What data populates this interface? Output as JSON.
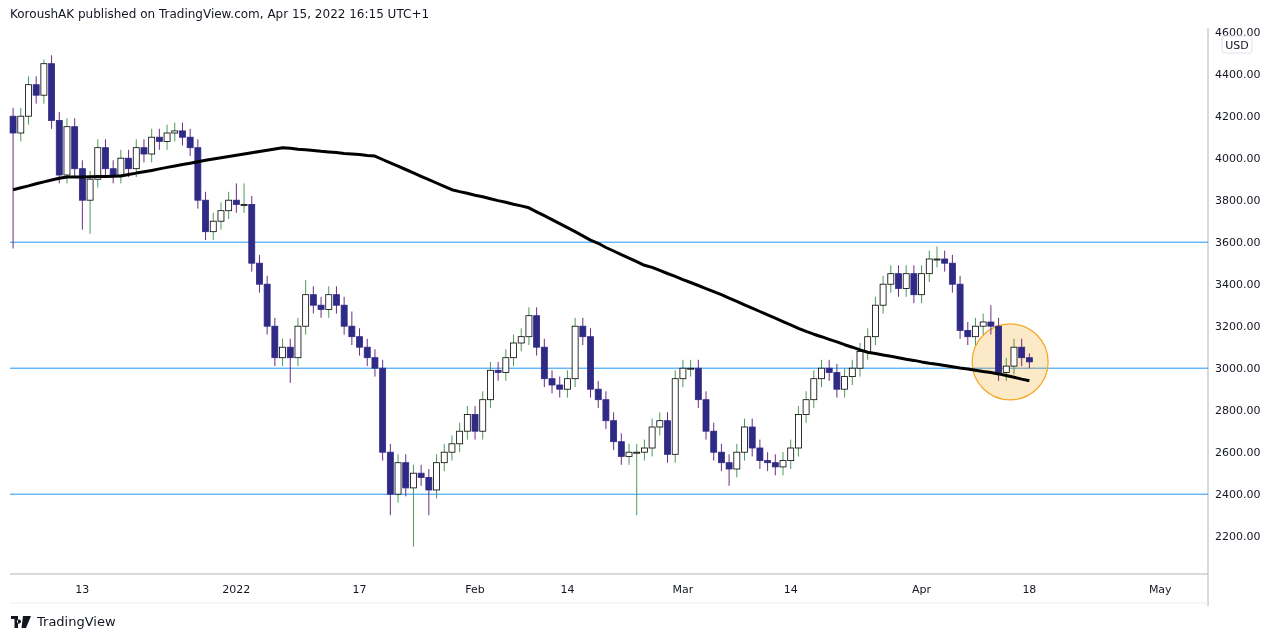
{
  "header": {
    "text": "KoroushAK published on TradingView.com, Apr 15, 2022 16:15 UTC+1"
  },
  "chart": {
    "chart_data": {
      "type": "candlestick",
      "ylabel": "USD",
      "ylim": [
        2020,
        4620
      ],
      "yticks": [
        {
          "value": 4600,
          "label": "4600.00"
        },
        {
          "value": 4400,
          "label": "4400.00"
        },
        {
          "value": 4200,
          "label": "4200.00"
        },
        {
          "value": 4000,
          "label": "4000.00"
        },
        {
          "value": 3800,
          "label": "3800.00"
        },
        {
          "value": 3600,
          "label": "3600.00"
        },
        {
          "value": 3400,
          "label": "3400.00"
        },
        {
          "value": 3200,
          "label": "3200.00"
        },
        {
          "value": 3000,
          "label": "3000.00"
        },
        {
          "value": 2800,
          "label": "2800.00"
        },
        {
          "value": 2600,
          "label": "2600.00"
        },
        {
          "value": 2400,
          "label": "2400.00"
        },
        {
          "value": 2200,
          "label": "2200.00"
        }
      ],
      "categories": [
        null,
        null,
        null,
        null,
        null,
        null,
        null,
        null,
        null,
        "13",
        null,
        null,
        null,
        null,
        null,
        null,
        null,
        null,
        null,
        null,
        null,
        null,
        null,
        null,
        null,
        null,
        null,
        null,
        null,
        "2022",
        null,
        null,
        null,
        null,
        null,
        null,
        null,
        null,
        null,
        null,
        null,
        null,
        null,
        null,
        null,
        "17",
        null,
        null,
        null,
        null,
        null,
        null,
        null,
        null,
        null,
        null,
        null,
        null,
        null,
        null,
        "Feb",
        null,
        null,
        null,
        null,
        null,
        null,
        null,
        null,
        null,
        null,
        null,
        "14",
        null,
        null,
        null,
        null,
        null,
        null,
        null,
        null,
        null,
        null,
        null,
        null,
        null,
        null,
        "Mar",
        null,
        null,
        null,
        null,
        null,
        null,
        null,
        null,
        null,
        null,
        null,
        null,
        null,
        "14",
        null,
        null,
        null,
        null,
        null,
        null,
        null,
        null,
        null,
        null,
        null,
        null,
        null,
        null,
        null,
        null,
        "Apr",
        null,
        null,
        null,
        null,
        null,
        null,
        null,
        null,
        null,
        null,
        null,
        null,
        null,
        "18",
        null,
        null,
        null,
        null,
        null,
        null,
        null,
        null,
        null,
        null,
        null,
        null,
        null,
        null,
        null,
        null,
        "May",
        null,
        null,
        null,
        null,
        null,
        null
      ],
      "ohlc": [
        [
          4200,
          4240,
          3570,
          4120
        ],
        [
          4120,
          4240,
          4080,
          4200
        ],
        [
          4200,
          4390,
          4160,
          4350
        ],
        [
          4350,
          4390,
          4260,
          4300
        ],
        [
          4300,
          4470,
          4260,
          4450
        ],
        [
          4450,
          4490,
          4140,
          4180
        ],
        [
          4180,
          4220,
          3880,
          3920
        ],
        [
          3920,
          4190,
          3880,
          4150
        ],
        [
          4150,
          4190,
          3910,
          3950
        ],
        [
          3950,
          3990,
          3660,
          3800
        ],
        [
          3800,
          3940,
          3640,
          3900
        ],
        [
          3900,
          4090,
          3860,
          4050
        ],
        [
          4050,
          4090,
          3910,
          3950
        ],
        [
          3950,
          3990,
          3880,
          3920
        ],
        [
          3920,
          4040,
          3880,
          4000
        ],
        [
          4000,
          4040,
          3910,
          3950
        ],
        [
          3950,
          4090,
          3910,
          4050
        ],
        [
          4050,
          4090,
          3980,
          4020
        ],
        [
          4020,
          4140,
          3980,
          4100
        ],
        [
          4100,
          4140,
          4040,
          4080
        ],
        [
          4080,
          4160,
          4040,
          4120
        ],
        [
          4120,
          4170,
          4080,
          4130
        ],
        [
          4130,
          4170,
          4060,
          4100
        ],
        [
          4100,
          4140,
          4010,
          4050
        ],
        [
          4050,
          4090,
          3760,
          3800
        ],
        [
          3800,
          3840,
          3610,
          3650
        ],
        [
          3650,
          3740,
          3610,
          3700
        ],
        [
          3700,
          3790,
          3660,
          3750
        ],
        [
          3750,
          3840,
          3710,
          3800
        ],
        [
          3800,
          3880,
          3740,
          3780
        ],
        [
          3780,
          3880,
          3740,
          3780
        ],
        [
          3780,
          3820,
          3460,
          3500
        ],
        [
          3500,
          3540,
          3360,
          3400
        ],
        [
          3400,
          3440,
          3160,
          3200
        ],
        [
          3200,
          3240,
          3010,
          3050
        ],
        [
          3050,
          3140,
          3010,
          3100
        ],
        [
          3100,
          3140,
          2930,
          3050
        ],
        [
          3050,
          3240,
          3010,
          3200
        ],
        [
          3200,
          3420,
          3160,
          3350
        ],
        [
          3350,
          3390,
          3260,
          3300
        ],
        [
          3300,
          3340,
          3240,
          3280
        ],
        [
          3280,
          3390,
          3240,
          3350
        ],
        [
          3350,
          3390,
          3260,
          3300
        ],
        [
          3300,
          3340,
          3160,
          3200
        ],
        [
          3200,
          3270,
          3110,
          3150
        ],
        [
          3150,
          3190,
          3060,
          3100
        ],
        [
          3100,
          3140,
          3010,
          3050
        ],
        [
          3050,
          3090,
          2960,
          3000
        ],
        [
          3000,
          3040,
          2560,
          2600
        ],
        [
          2600,
          2640,
          2300,
          2400
        ],
        [
          2400,
          2590,
          2360,
          2550
        ],
        [
          2550,
          2590,
          2390,
          2430
        ],
        [
          2430,
          2540,
          2150,
          2500
        ],
        [
          2500,
          2540,
          2440,
          2480
        ],
        [
          2480,
          2520,
          2300,
          2420
        ],
        [
          2420,
          2590,
          2380,
          2550
        ],
        [
          2550,
          2640,
          2510,
          2600
        ],
        [
          2600,
          2680,
          2560,
          2640
        ],
        [
          2640,
          2740,
          2600,
          2700
        ],
        [
          2700,
          2820,
          2660,
          2780
        ],
        [
          2780,
          2820,
          2660,
          2700
        ],
        [
          2700,
          2890,
          2660,
          2850
        ],
        [
          2850,
          3030,
          2810,
          2990
        ],
        [
          2990,
          3030,
          2940,
          2980
        ],
        [
          2980,
          3090,
          2940,
          3050
        ],
        [
          3050,
          3160,
          3010,
          3120
        ],
        [
          3120,
          3190,
          3080,
          3150
        ],
        [
          3150,
          3290,
          3110,
          3250
        ],
        [
          3250,
          3290,
          3060,
          3100
        ],
        [
          3100,
          3140,
          2910,
          2950
        ],
        [
          2950,
          2990,
          2880,
          2920
        ],
        [
          2920,
          2960,
          2860,
          2900
        ],
        [
          2900,
          2990,
          2860,
          2950
        ],
        [
          2950,
          3240,
          2910,
          3200
        ],
        [
          3200,
          3240,
          3110,
          3150
        ],
        [
          3150,
          3190,
          2860,
          2900
        ],
        [
          2900,
          2940,
          2810,
          2850
        ],
        [
          2850,
          2890,
          2710,
          2750
        ],
        [
          2750,
          2790,
          2610,
          2650
        ],
        [
          2650,
          2690,
          2540,
          2580
        ],
        [
          2580,
          2640,
          2540,
          2600
        ],
        [
          2600,
          2640,
          2300,
          2600
        ],
        [
          2600,
          2660,
          2560,
          2620
        ],
        [
          2620,
          2760,
          2580,
          2720
        ],
        [
          2720,
          2790,
          2680,
          2750
        ],
        [
          2750,
          2790,
          2550,
          2590
        ],
        [
          2590,
          2990,
          2550,
          2950
        ],
        [
          2950,
          3040,
          2910,
          3000
        ],
        [
          3000,
          3040,
          2960,
          3000
        ],
        [
          3000,
          3040,
          2810,
          2850
        ],
        [
          2850,
          2890,
          2660,
          2700
        ],
        [
          2700,
          2740,
          2560,
          2600
        ],
        [
          2600,
          2640,
          2510,
          2550
        ],
        [
          2550,
          2590,
          2440,
          2520
        ],
        [
          2520,
          2640,
          2480,
          2600
        ],
        [
          2600,
          2760,
          2560,
          2720
        ],
        [
          2720,
          2760,
          2580,
          2620
        ],
        [
          2620,
          2660,
          2520,
          2560
        ],
        [
          2560,
          2600,
          2510,
          2550
        ],
        [
          2550,
          2590,
          2490,
          2530
        ],
        [
          2530,
          2600,
          2490,
          2560
        ],
        [
          2560,
          2660,
          2520,
          2620
        ],
        [
          2620,
          2820,
          2580,
          2780
        ],
        [
          2780,
          2890,
          2740,
          2850
        ],
        [
          2850,
          2990,
          2810,
          2950
        ],
        [
          2950,
          3040,
          2910,
          3000
        ],
        [
          3000,
          3040,
          2940,
          2980
        ],
        [
          2980,
          3020,
          2860,
          2900
        ],
        [
          2900,
          3000,
          2860,
          2960
        ],
        [
          2960,
          3040,
          2920,
          3000
        ],
        [
          3000,
          3120,
          2960,
          3080
        ],
        [
          3080,
          3190,
          3040,
          3150
        ],
        [
          3150,
          3340,
          3110,
          3300
        ],
        [
          3300,
          3440,
          3260,
          3400
        ],
        [
          3400,
          3490,
          3360,
          3450
        ],
        [
          3450,
          3490,
          3340,
          3380
        ],
        [
          3380,
          3490,
          3340,
          3450
        ],
        [
          3450,
          3490,
          3310,
          3350
        ],
        [
          3350,
          3490,
          3310,
          3450
        ],
        [
          3450,
          3560,
          3410,
          3520
        ],
        [
          3520,
          3580,
          3480,
          3520
        ],
        [
          3520,
          3560,
          3460,
          3500
        ],
        [
          3500,
          3540,
          3360,
          3400
        ],
        [
          3400,
          3440,
          3140,
          3180
        ],
        [
          3180,
          3220,
          3110,
          3150
        ],
        [
          3150,
          3240,
          3110,
          3200
        ],
        [
          3200,
          3260,
          3160,
          3220
        ],
        [
          3220,
          3300,
          3160,
          3200
        ],
        [
          3200,
          3240,
          2940,
          2980
        ],
        [
          2980,
          3050,
          2940,
          3010
        ],
        [
          3010,
          3140,
          2970,
          3100
        ],
        [
          3100,
          3140,
          3010,
          3050
        ],
        [
          3050,
          3070,
          3000,
          3030
        ],
        null,
        null,
        null,
        null,
        null,
        null,
        null,
        null,
        null,
        null,
        null,
        null,
        null,
        null,
        null,
        null,
        null,
        null,
        null,
        null,
        null,
        null,
        null
      ],
      "series": [
        {
          "type": "line",
          "color": "#000000",
          "values": [
            3850,
            3859,
            3868,
            3878,
            3887,
            3896,
            3905,
            3910,
            3911,
            3911,
            3912,
            3913,
            3913,
            3914,
            3915,
            3922,
            3929,
            3935,
            3942,
            3949,
            3956,
            3963,
            3970,
            3976,
            3983,
            3990,
            3996,
            4002,
            4008,
            4014,
            4020,
            4026,
            4032,
            4038,
            4044,
            4050,
            4047,
            4043,
            4040,
            4037,
            4033,
            4030,
            4027,
            4023,
            4020,
            4017,
            4013,
            4010,
            3994,
            3978,
            3962,
            3946,
            3930,
            3914,
            3898,
            3882,
            3866,
            3850,
            3841,
            3833,
            3824,
            3816,
            3807,
            3798,
            3790,
            3781,
            3773,
            3764,
            3745,
            3726,
            3707,
            3688,
            3669,
            3650,
            3630,
            3610,
            3595,
            3575,
            3558,
            3541,
            3524,
            3507,
            3490,
            3480,
            3466,
            3451,
            3437,
            3422,
            3408,
            3394,
            3379,
            3365,
            3350,
            3334,
            3318,
            3302,
            3286,
            3270,
            3254,
            3238,
            3222,
            3206,
            3190,
            3175,
            3162,
            3150,
            3137,
            3125,
            3112,
            3100,
            3087,
            3076,
            3070,
            3063,
            3057,
            3050,
            3043,
            3037,
            3030,
            3024,
            3019,
            3013,
            3007,
            3001,
            2996,
            2990,
            2984,
            2979,
            2973,
            2965,
            2957,
            2948,
            2940,
            null,
            null,
            null,
            null,
            null,
            null,
            null,
            null,
            null,
            null,
            null,
            null,
            null,
            null,
            null,
            null,
            null,
            null,
            null,
            null,
            null,
            null,
            null
          ]
        }
      ],
      "ref_lines": [
        {
          "axis": "y",
          "value": 3600
        },
        {
          "axis": "y",
          "value": 3000
        },
        {
          "axis": "y",
          "value": 2400
        }
      ]
    }
  },
  "footer": {
    "brand": "TradingView"
  }
}
